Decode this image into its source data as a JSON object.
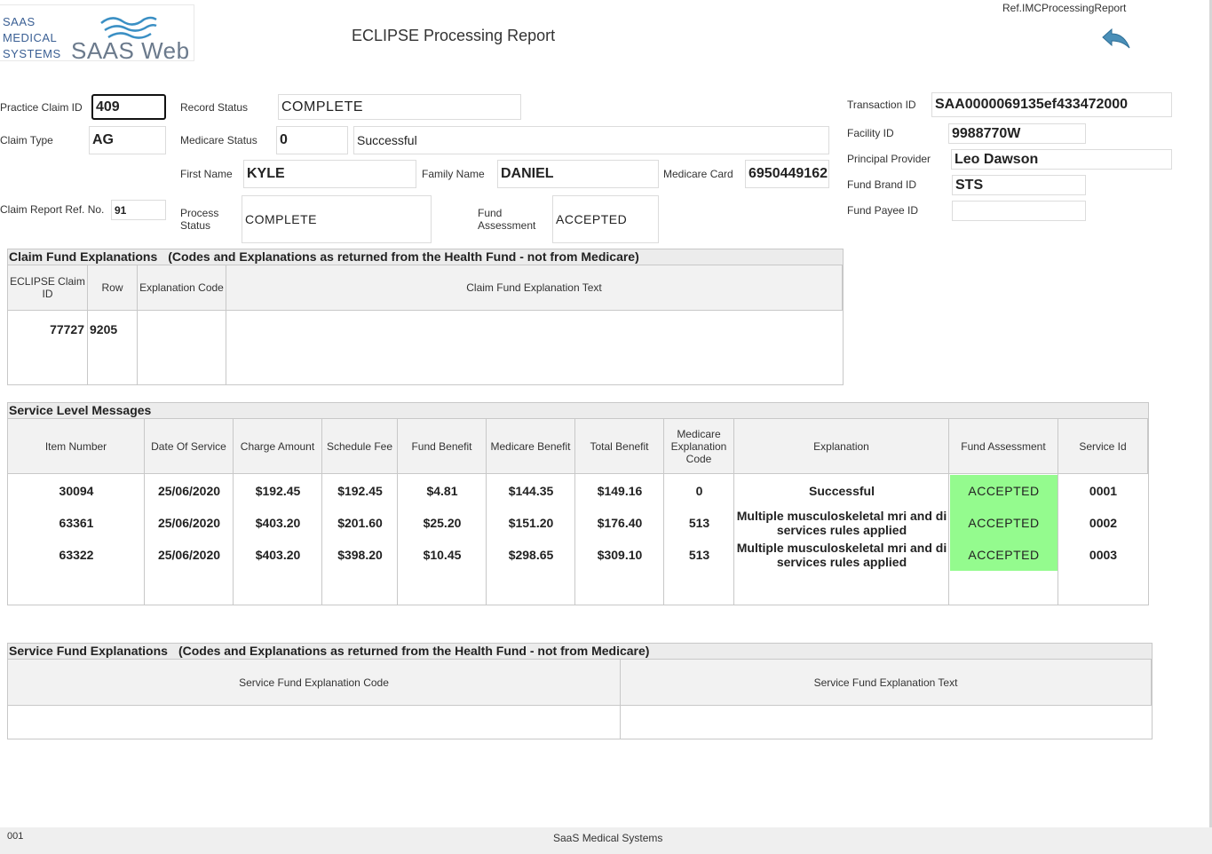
{
  "header": {
    "logo_small_line1": "SAAS",
    "logo_small_line2": "MEDICAL",
    "logo_small_line3": "SYSTEMS",
    "logo_big": "SAAS Web",
    "title": "ECLIPSE Processing Report",
    "ref": "Ref.IMCProcessingReport",
    "back_icon": "back-arrow-icon"
  },
  "claim": {
    "practice_claim_id_label": "Practice Claim ID",
    "practice_claim_id": "409",
    "claim_type_label": "Claim Type",
    "claim_type": "AG",
    "claim_report_ref_label": "Claim Report Ref. No.",
    "claim_report_ref": "91",
    "record_status_label": "Record Status",
    "record_status": "COMPLETE",
    "medicare_status_label": "Medicare Status",
    "medicare_status_code": "0",
    "medicare_status_text": "Successful",
    "first_name_label": "First Name",
    "first_name": "KYLE",
    "family_name_label": "Family Name",
    "family_name": "DANIEL",
    "medicare_card_label": "Medicare Card",
    "medicare_card": "6950449162",
    "process_status_label_1": "Process",
    "process_status_label_2": "Status",
    "process_status": "COMPLETE",
    "fund_assessment_label_1": "Fund",
    "fund_assessment_label_2": "Assessment",
    "fund_assessment": "ACCEPTED",
    "transaction_id_label": "Transaction ID",
    "transaction_id": "SAA0000069135ef433472000",
    "facility_id_label": "Facility ID",
    "facility_id": "9988770W",
    "principal_provider_label": "Principal Provider",
    "principal_provider": "Leo Dawson",
    "fund_brand_id_label": "Fund Brand ID",
    "fund_brand_id": "STS",
    "fund_payee_id_label": "Fund Payee ID",
    "fund_payee_id": ""
  },
  "claim_fund_explanations": {
    "title": "Claim Fund Explanations",
    "subtitle": "(Codes and Explanations as returned from the Health Fund - not from Medicare)",
    "headers": [
      "ECLIPSE Claim ID",
      "Row",
      "Explanation Code",
      "Claim Fund Explanation Text"
    ],
    "rows": [
      {
        "eclipse_claim_id": "77727",
        "row": "9205",
        "code": "",
        "text": ""
      }
    ]
  },
  "service_level_messages": {
    "title": "Service Level Messages",
    "headers": [
      "Item Number",
      "Date Of Service",
      "Charge Amount",
      "Schedule Fee",
      "Fund Benefit",
      "Medicare Benefit",
      "Total Benefit",
      "Medicare Explanation Code",
      "Explanation",
      "Fund Assessment",
      "Service Id"
    ],
    "rows": [
      {
        "item": "30094",
        "date": "25/06/2020",
        "charge": "$192.45",
        "schedule": "$192.45",
        "fund": "$4.81",
        "medicare": "$144.35",
        "total": "$149.16",
        "code": "0",
        "explanation": "Successful",
        "assessment": "ACCEPTED",
        "service_id": "0001"
      },
      {
        "item": "63361",
        "date": "25/06/2020",
        "charge": "$403.20",
        "schedule": "$201.60",
        "fund": "$25.20",
        "medicare": "$151.20",
        "total": "$176.40",
        "code": "513",
        "explanation": "Multiple musculoskeletal mri and di services rules applied",
        "assessment": "ACCEPTED",
        "service_id": "0002"
      },
      {
        "item": "63322",
        "date": "25/06/2020",
        "charge": "$403.20",
        "schedule": "$398.20",
        "fund": "$10.45",
        "medicare": "$298.65",
        "total": "$309.10",
        "code": "513",
        "explanation": "Multiple musculoskeletal mri and di services rules applied",
        "assessment": "ACCEPTED",
        "service_id": "0003"
      }
    ],
    "accepted_color": "#94fb8e"
  },
  "service_fund_explanations": {
    "title": "Service Fund Explanations",
    "subtitle": "(Codes and Explanations as returned from the Health Fund - not from Medicare)",
    "headers": [
      "Service Fund Explanation Code",
      "Service Fund Explanation Text"
    ]
  },
  "footer": {
    "code": "001",
    "company": "SaaS Medical Systems"
  }
}
